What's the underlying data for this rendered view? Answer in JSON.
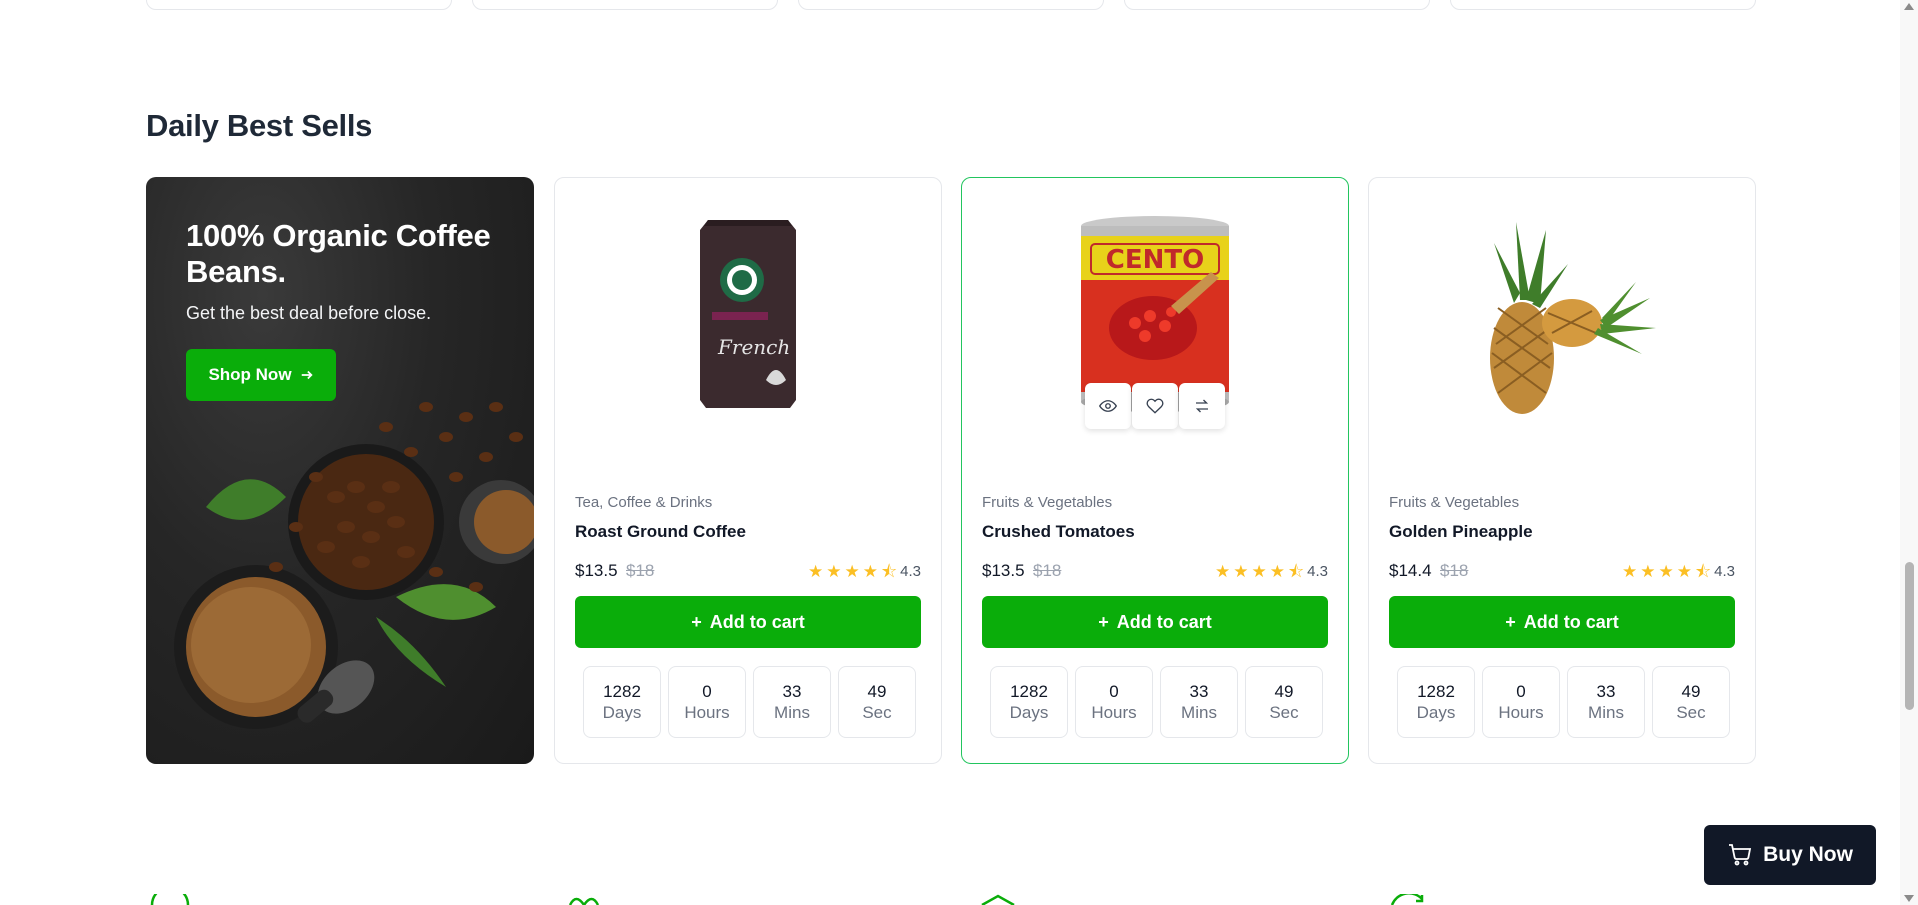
{
  "section": {
    "title": "Daily Best Sells"
  },
  "promo": {
    "title": "100% Organic Coffee Beans.",
    "subtitle": "Get the best deal before close.",
    "button_label": "Shop Now",
    "button_icon": "arrow-right-icon"
  },
  "products": [
    {
      "category": "Tea, Coffee & Drinks",
      "name": "Roast Ground Coffee",
      "price": "$13.5",
      "old_price": "$18",
      "rating": "4.3",
      "cart_label": "Add to cart"
    },
    {
      "category": "Fruits & Vegetables",
      "name": "Crushed Tomatoes",
      "price": "$13.5",
      "old_price": "$18",
      "rating": "4.3",
      "cart_label": "Add to cart",
      "quick_actions": [
        "eye-icon",
        "heart-icon",
        "compare-icon"
      ]
    },
    {
      "category": "Fruits & Vegetables",
      "name": "Golden Pineapple",
      "price": "$14.4",
      "old_price": "$18",
      "rating": "4.3",
      "cart_label": "Add to cart"
    }
  ],
  "timer": [
    {
      "value": "1282",
      "label": "Days"
    },
    {
      "value": "0",
      "label": "Hours"
    },
    {
      "value": "33",
      "label": "Mins"
    },
    {
      "value": "49",
      "label": "Sec"
    }
  ],
  "product_images": {
    "coffee_bag_brand": "French",
    "can_brand": "CENTO"
  },
  "buy_now": {
    "label": "Buy Now",
    "icon": "cart-icon"
  },
  "colors": {
    "accent": "#0aad0a",
    "dark": "#111827",
    "star": "#fbbf24",
    "active_border": "#22c55e"
  }
}
